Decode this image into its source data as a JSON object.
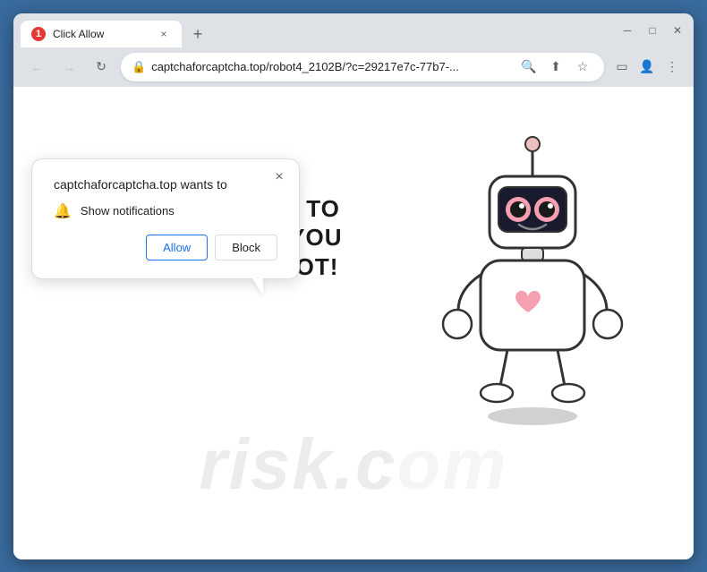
{
  "window": {
    "title_bar": {
      "tab_favicon_text": "1",
      "tab_title": "Click Allow",
      "tab_close_icon": "×",
      "new_tab_icon": "+",
      "minimize_icon": "─",
      "maximize_icon": "□",
      "close_icon": "✕"
    },
    "address_bar": {
      "back_icon": "←",
      "forward_icon": "→",
      "reload_icon": "↻",
      "lock_icon": "🔒",
      "url": "captchaforcaptcha.top/robot4_2102B/?c=29217e7c-77b7-...",
      "search_icon": "🔍",
      "share_icon": "⬆",
      "bookmark_icon": "☆",
      "sidebar_icon": "▭",
      "profile_icon": "👤",
      "menu_icon": "⋮"
    }
  },
  "notification_bubble": {
    "title": "captchaforcaptcha.top wants to",
    "close_icon": "×",
    "bell_icon": "🔔",
    "description": "Show notifications",
    "allow_button": "Allow",
    "block_button": "Block"
  },
  "page": {
    "captcha_line1": "CLICK «ALLOW» TO CONFIRM THAT YOU",
    "captcha_line2": "ARE NOT A ROBOT!",
    "watermark": "risk.c..."
  }
}
